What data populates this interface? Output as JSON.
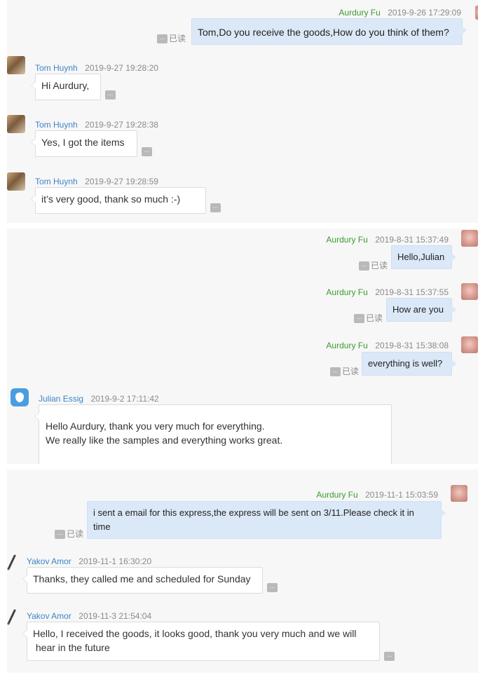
{
  "read_label": "已读",
  "more_glyph": "...",
  "colors": {
    "sender_self": "#3c9a2e",
    "sender_other": "#3d85c6",
    "bubble_out": "#dbe8f7",
    "bubble_in": "#ffffff"
  },
  "panel1": {
    "messages": [
      {
        "sender": "Aurdury Fu",
        "time": "2019-9-26 17:29:09",
        "text": "Tom,Do you receive the goods,How do you think of them?"
      },
      {
        "sender": "Tom Huynh",
        "time": "2019-9-27 19:28:20",
        "text": "Hi Aurdury,"
      },
      {
        "sender": "Tom Huynh",
        "time": "2019-9-27 19:28:38",
        "text": "Yes, I got the items"
      },
      {
        "sender": "Tom Huynh",
        "time": "2019-9-27 19:28:59",
        "text": "it’s very good, thank so much :-)"
      }
    ]
  },
  "panel2": {
    "messages": [
      {
        "sender": "Aurdury Fu",
        "time": "2019-8-31 15:37:49",
        "text": "Hello,Julian"
      },
      {
        "sender": "Aurdury Fu",
        "time": "2019-8-31 15:37:55",
        "text": "How are you"
      },
      {
        "sender": "Aurdury Fu",
        "time": "2019-8-31 15:38:08",
        "text": "everything is well?"
      },
      {
        "sender": "Julian Essig",
        "time": "2019-9-2 17:11:42",
        "line1": "Hello Aurdury, thank you very much for everything.",
        "line2": "We really like the samples and everything works great."
      }
    ]
  },
  "panel3": {
    "messages": [
      {
        "sender": "Aurdury Fu",
        "time": "2019-11-1 15:03:59",
        "line1": "i sent a email for this express,the express will be sent on 3/11.Please check it in",
        "line2": "time"
      },
      {
        "sender": "Yakov Amor",
        "time": "2019-11-1 16:30:20",
        "text": "Thanks, they called me and scheduled for Sunday"
      },
      {
        "sender": "Yakov Amor",
        "time": "2019-11-3 21:54:04",
        "line1": "Hello, I received the goods, it looks good, thank you very much and we will",
        "line2": " hear in the future"
      }
    ]
  }
}
